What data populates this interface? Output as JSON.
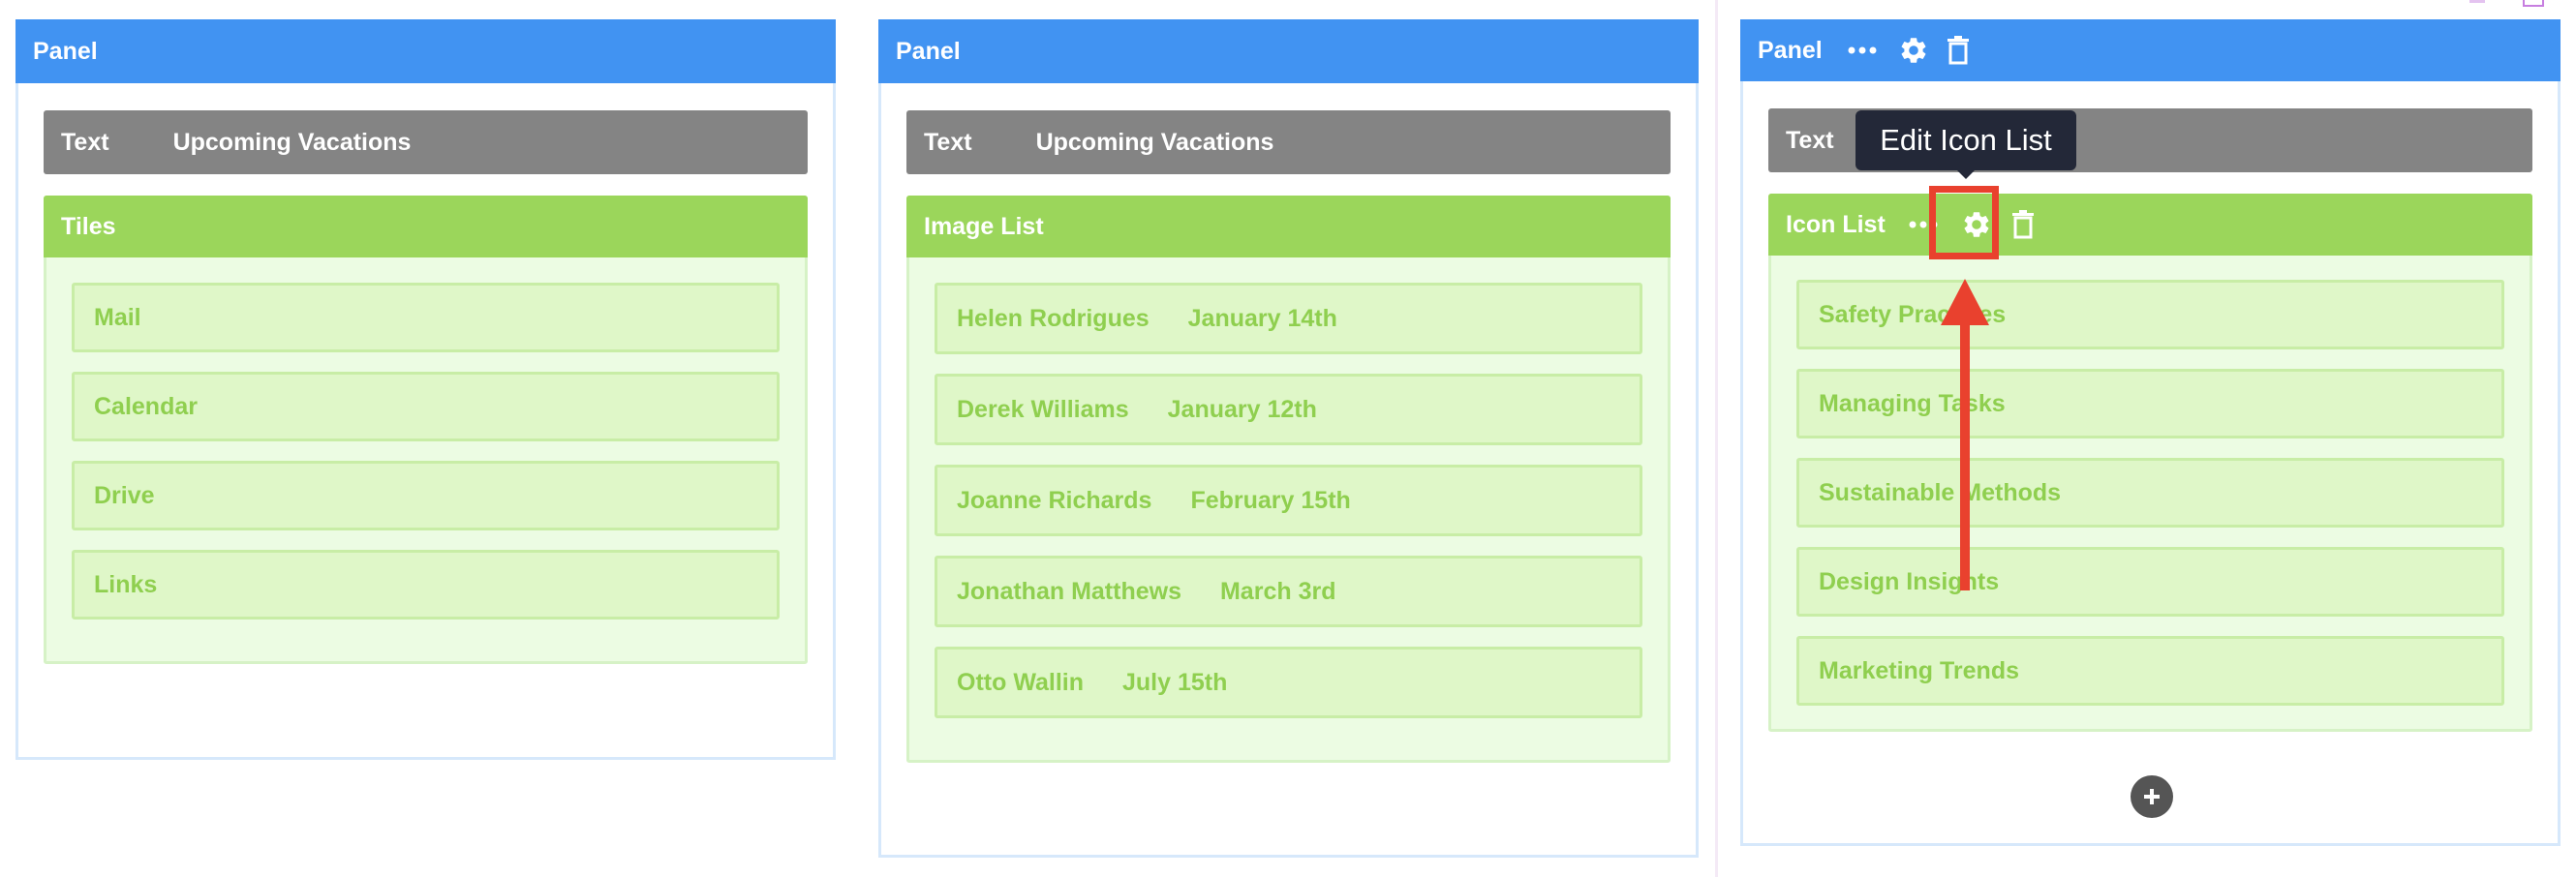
{
  "panels": [
    {
      "header": "Panel",
      "text": {
        "label": "Text",
        "value": "Upcoming Vacations"
      },
      "list": {
        "title": "Tiles",
        "items": [
          {
            "label": "Mail"
          },
          {
            "label": "Calendar"
          },
          {
            "label": "Drive"
          },
          {
            "label": "Links"
          }
        ]
      }
    },
    {
      "header": "Panel",
      "text": {
        "label": "Text",
        "value": "Upcoming Vacations"
      },
      "list": {
        "title": "Image List",
        "items": [
          {
            "label": "Helen Rodrigues",
            "sub": "January 14th"
          },
          {
            "label": "Derek Williams",
            "sub": "January 12th"
          },
          {
            "label": "Joanne Richards",
            "sub": "February 15th"
          },
          {
            "label": "Jonathan Matthews",
            "sub": "March 3rd"
          },
          {
            "label": "Otto Wallin",
            "sub": "July 15th"
          }
        ]
      }
    },
    {
      "header": "Panel",
      "header_icons": [
        "more-icon",
        "gear-icon",
        "trash-icon"
      ],
      "text": {
        "label": "Text"
      },
      "list": {
        "title": "Icon List",
        "title_icons": [
          "more-icon",
          "gear-icon",
          "trash-icon"
        ],
        "items": [
          {
            "label": "Safety Practices"
          },
          {
            "label": "Managing Tasks"
          },
          {
            "label": "Sustainable Methods"
          },
          {
            "label": "Design Insights"
          },
          {
            "label": "Marketing Trends"
          }
        ]
      },
      "add_icon": "plus-icon"
    }
  ],
  "tooltip": "Edit Icon List",
  "annotation": {
    "arrow_color": "#e9412e",
    "target": "gear-icon"
  },
  "colors": {
    "panel_header": "#4193f2",
    "text_bar": "#848484",
    "list_header": "#9bd65b",
    "item_bg": "#dff7c8",
    "item_text": "#8fcf4f"
  }
}
